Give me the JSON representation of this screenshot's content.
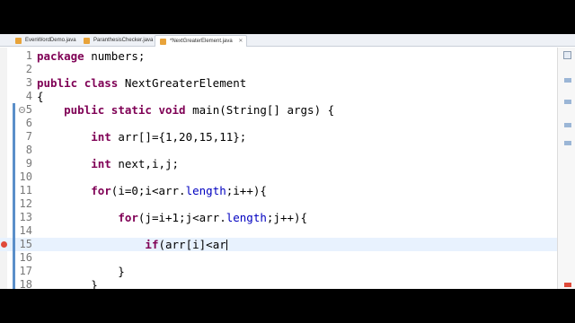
{
  "tabs": [
    {
      "label": "EvenWordDemo.java",
      "active": false
    },
    {
      "label": "ParanthesisChecker.java",
      "active": false
    },
    {
      "label": "*NextGreaterElement.java",
      "active": true
    }
  ],
  "editor": {
    "lines": [
      {
        "num": "1",
        "segments": [
          {
            "t": "package",
            "k": "kw"
          },
          {
            "t": " numbers;"
          }
        ]
      },
      {
        "num": "2",
        "segments": []
      },
      {
        "num": "3",
        "segments": [
          {
            "t": "public",
            "k": "kw"
          },
          {
            "t": " "
          },
          {
            "t": "class",
            "k": "kw"
          },
          {
            "t": " NextGreaterElement"
          }
        ]
      },
      {
        "num": "4",
        "segments": [
          {
            "t": "{"
          }
        ]
      },
      {
        "num": "5",
        "segments": [
          {
            "t": "    "
          },
          {
            "t": "public",
            "k": "kw"
          },
          {
            "t": " "
          },
          {
            "t": "static",
            "k": "kw"
          },
          {
            "t": " "
          },
          {
            "t": "void",
            "k": "kw"
          },
          {
            "t": " main(String[] args) {"
          }
        ]
      },
      {
        "num": "6",
        "segments": []
      },
      {
        "num": "7",
        "segments": [
          {
            "t": "        "
          },
          {
            "t": "int",
            "k": "kw"
          },
          {
            "t": " arr[]={1,20,15,11};"
          }
        ]
      },
      {
        "num": "8",
        "segments": []
      },
      {
        "num": "9",
        "segments": [
          {
            "t": "        "
          },
          {
            "t": "int",
            "k": "kw"
          },
          {
            "t": " next,i,j;"
          }
        ]
      },
      {
        "num": "10",
        "segments": []
      },
      {
        "num": "11",
        "segments": [
          {
            "t": "        "
          },
          {
            "t": "for",
            "k": "kw"
          },
          {
            "t": "(i=0;i<arr."
          },
          {
            "t": "length",
            "k": "fld"
          },
          {
            "t": ";i++){"
          }
        ]
      },
      {
        "num": "12",
        "segments": []
      },
      {
        "num": "13",
        "segments": [
          {
            "t": "            "
          },
          {
            "t": "for",
            "k": "kw"
          },
          {
            "t": "(j=i+1;j<arr."
          },
          {
            "t": "length",
            "k": "fld"
          },
          {
            "t": ";j++){"
          }
        ]
      },
      {
        "num": "14",
        "segments": []
      },
      {
        "num": "15",
        "segments": [
          {
            "t": "                "
          },
          {
            "t": "if",
            "k": "kw"
          },
          {
            "t": "(arr[i]<ar"
          }
        ],
        "cursor": true
      },
      {
        "num": "16",
        "segments": []
      },
      {
        "num": "17",
        "segments": [
          {
            "t": "            }"
          }
        ]
      },
      {
        "num": "18",
        "segments": [
          {
            "t": "        }"
          }
        ]
      }
    ]
  }
}
